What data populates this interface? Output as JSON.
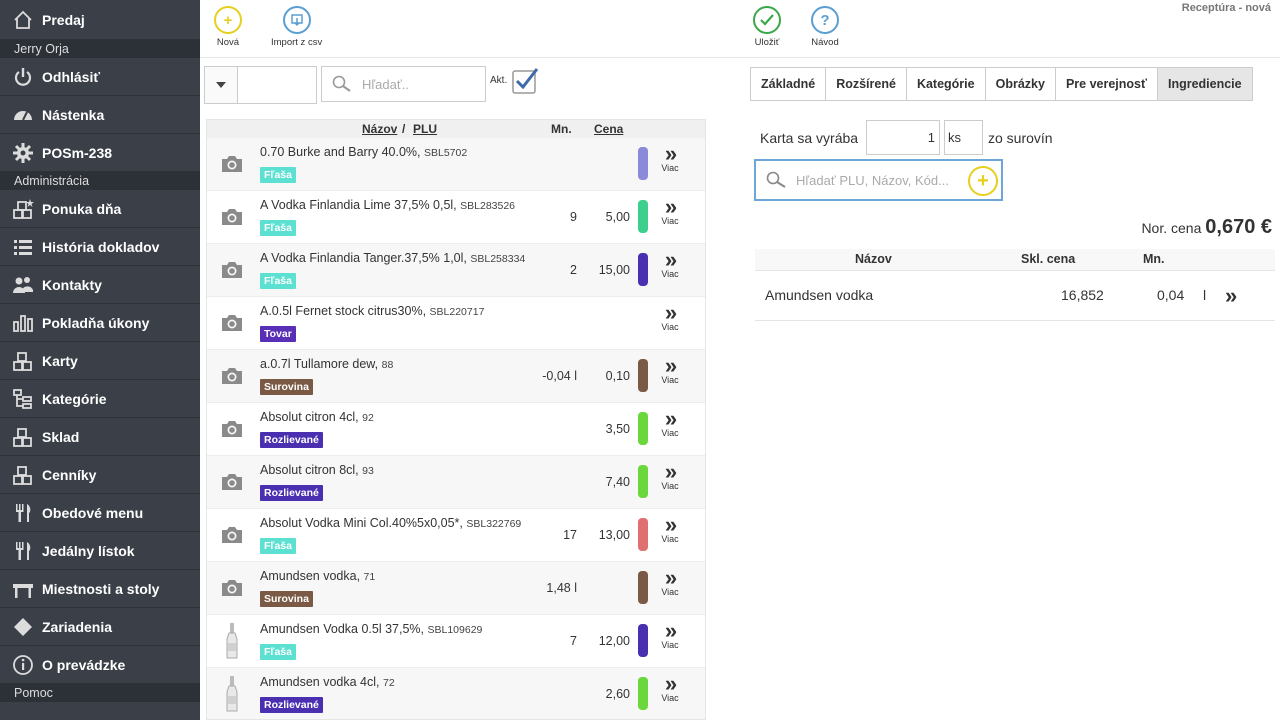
{
  "sidebar": {
    "items": [
      {
        "label": "Predaj",
        "icon": "home-icon"
      },
      {
        "section": "Jerry Orja"
      },
      {
        "label": "Odhlásiť",
        "icon": "power-icon"
      },
      {
        "label": "Nástenka",
        "icon": "dashboard-icon"
      },
      {
        "label": "POSm-238",
        "icon": "gear-icon"
      },
      {
        "section": "Administrácia"
      },
      {
        "label": "Ponuka dňa",
        "icon": "boxes-star-icon"
      },
      {
        "label": "História dokladov",
        "icon": "list-icon"
      },
      {
        "label": "Kontakty",
        "icon": "users-icon"
      },
      {
        "label": "Pokladňa úkony",
        "icon": "bar-chart-icon"
      },
      {
        "label": "Karty",
        "icon": "boxes-icon"
      },
      {
        "label": "Kategórie",
        "icon": "tree-icon"
      },
      {
        "label": "Sklad",
        "icon": "boxes-icon"
      },
      {
        "label": "Cenníky",
        "icon": "boxes-icon"
      },
      {
        "label": "Obedové menu",
        "icon": "fork-knife-icon"
      },
      {
        "label": "Jedálny lístok",
        "icon": "fork-knife-icon"
      },
      {
        "label": "Miestnosti a stoly",
        "icon": "table-icon"
      },
      {
        "label": "Zariadenia",
        "icon": "diamond-icon"
      },
      {
        "label": "O prevádzke",
        "icon": "info-icon"
      },
      {
        "section": "Pomoc"
      }
    ]
  },
  "toolbar": {
    "new_label": "Nová",
    "import_label": "Import z csv",
    "save_label": "Uložiť",
    "help_label": "Návod",
    "page_title": "Receptúra - nová"
  },
  "filter": {
    "search_placeholder": "Hľadať..",
    "akt_label": "Akt."
  },
  "list": {
    "columns": {
      "name": "Názov",
      "plu": "PLU",
      "qty": "Mn.",
      "price": "Cena"
    },
    "more_label": "Viac",
    "rows": [
      {
        "name": "0.70 Burke and Barry 40.0%,",
        "code": "SBL5702",
        "tag": "Fľaša",
        "tag_color": "#5ce0d2",
        "qty": "",
        "price": "",
        "color": "#8a8ad8",
        "image": "camera"
      },
      {
        "name": "A Vodka Finlandia Lime 37,5% 0,5l,",
        "code": "SBL283526",
        "tag": "Fľaša",
        "tag_color": "#5ce0d2",
        "qty": "9",
        "price": "5,00",
        "color": "#3cd08c",
        "image": "camera"
      },
      {
        "name": "A Vodka Finlandia Tanger.37,5% 1,0l,",
        "code": "SBL258334",
        "tag": "Fľaša",
        "tag_color": "#5ce0d2",
        "qty": "2",
        "price": "15,00",
        "color": "#4a2fb0",
        "image": "camera"
      },
      {
        "name": "A.0.5l Fernet stock citrus30%,",
        "code": "SBL220717",
        "tag": "Tovar",
        "tag_color": "#5a2fb8",
        "qty": "",
        "price": "",
        "color": "",
        "image": "camera"
      },
      {
        "name": "a.0.7l Tullamore dew,",
        "code": "88",
        "tag": "Surovina",
        "tag_color": "#7a5a45",
        "qty": "-0,04 l",
        "price": "0,10",
        "color": "#7a5a45",
        "image": "camera"
      },
      {
        "name": "Absolut citron 4cl,",
        "code": "92",
        "tag": "Rozlievané",
        "tag_color": "#4a2fb0",
        "qty": "",
        "price": "3,50",
        "color": "#6ad83c",
        "image": "camera"
      },
      {
        "name": "Absolut citron 8cl,",
        "code": "93",
        "tag": "Rozlievané",
        "tag_color": "#4a2fb0",
        "qty": "",
        "price": "7,40",
        "color": "#6ad83c",
        "image": "camera"
      },
      {
        "name": "Absolut Vodka Mini Col.40%5x0,05*,",
        "code": "SBL322769",
        "tag": "Fľaša",
        "tag_color": "#5ce0d2",
        "qty": "17",
        "price": "13,00",
        "color": "#e07070",
        "image": "camera"
      },
      {
        "name": "Amundsen vodka,",
        "code": "71",
        "tag": "Surovina",
        "tag_color": "#7a5a45",
        "qty": "1,48 l",
        "price": "",
        "color": "#7a5a45",
        "image": "camera"
      },
      {
        "name": "Amundsen Vodka 0.5l 37,5%,",
        "code": "SBL109629",
        "tag": "Fľaša",
        "tag_color": "#5ce0d2",
        "qty": "7",
        "price": "12,00",
        "color": "#4a2fb0",
        "image": "bottle"
      },
      {
        "name": "Amundsen vodka 4cl,",
        "code": "72",
        "tag": "Rozlievané",
        "tag_color": "#4a2fb0",
        "qty": "",
        "price": "2,60",
        "color": "#6ad83c",
        "image": "bottle"
      }
    ]
  },
  "tabs": [
    {
      "label": "Základné",
      "active": false
    },
    {
      "label": "Rozšírené",
      "active": false
    },
    {
      "label": "Kategórie",
      "active": false
    },
    {
      "label": "Obrázky",
      "active": false
    },
    {
      "label": "Pre verejnosť",
      "active": false
    },
    {
      "label": "Ingrediencie",
      "active": true
    }
  ],
  "recipe": {
    "makes_label": "Karta sa vyrába",
    "makes_qty": "1",
    "makes_unit": "ks",
    "from_label": "zo surovín",
    "search_placeholder": "Hľadať PLU, Názov, Kód...",
    "norm_price_label": "Nor. cena",
    "norm_price": "0,670 €",
    "columns": {
      "name": "Názov",
      "cost": "Skl. cena",
      "qty": "Mn."
    },
    "ingredients": [
      {
        "name": "Amundsen vodka",
        "cost": "16,852",
        "qty": "0,04",
        "unit": "l"
      }
    ]
  },
  "colors": {
    "sidebar_bg": "#3a3f48",
    "accent_yellow": "#e6cf1f",
    "accent_blue": "#5a9fd4",
    "accent_green": "#3aa84a"
  }
}
